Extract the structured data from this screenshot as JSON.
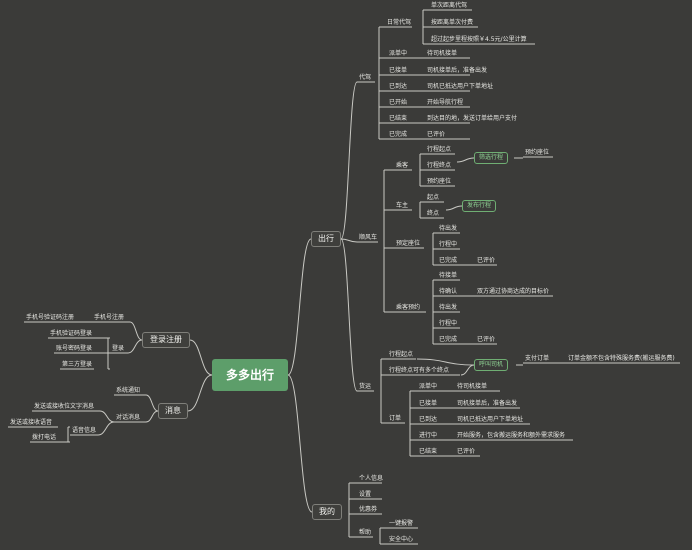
{
  "root": "多多出行",
  "left": {
    "login": {
      "label": "登录注册",
      "register": "手机号注册",
      "register_items": [
        "手机号验证码注册"
      ],
      "signin": "登录",
      "signin_items": [
        "手机验证码登录",
        "账号密码登录",
        "第三方登录"
      ]
    },
    "message": {
      "label": "消息",
      "system": "系统通知",
      "dialog": "对话消息",
      "dialog_items": [
        "发送或接收位文字消息"
      ],
      "voice": "语音信息",
      "voice_items": [
        "发送或接收语音",
        "拨打电话"
      ]
    }
  },
  "right": {
    "travel": {
      "label": "出行",
      "daijia": {
        "label": "代驾",
        "daily": "日常代驾",
        "daily_items": [
          "单次距离代驾",
          "按距离单次付费",
          "超过起步里程按照￥4.5元/公里计算"
        ],
        "states": [
          {
            "state": "派单中",
            "desc": "待司机接单"
          },
          {
            "state": "已接单",
            "desc": "司机接单后，准备出发"
          },
          {
            "state": "已到达",
            "desc": "司机已抵达用户下单地址"
          },
          {
            "state": "已开始",
            "desc": "开始导航行程"
          },
          {
            "state": "已结束",
            "desc": "到达目的地，发送订单给用户支付"
          },
          {
            "state": "已完成",
            "desc": "已评价"
          }
        ]
      },
      "shunfeng": {
        "label": "顺风车",
        "passenger": "乘客",
        "p_items": [
          "行程起点",
          "行程终点",
          "预约座位"
        ],
        "p_tag": "筛选行程",
        "p_next": "预约座位",
        "driver": "车主",
        "d_items": [
          "起点",
          "终点"
        ],
        "d_tag": "发布行程",
        "reserve": "预定座位",
        "r_items": [
          "待出发",
          "行程中",
          "已完成"
        ],
        "r_eval": "已评价",
        "pax_reserve": "乘客预约",
        "x_items": [
          "待接单",
          "待确认",
          "待出发",
          "行程中",
          "已完成"
        ],
        "x_confirm": "双方通过协商达成的目标价",
        "x_eval": "已评价"
      },
      "huoyun": {
        "label": "货运",
        "start": "行程起点",
        "ends": "行程终点可有多个终点",
        "tag": "呼叫司机",
        "pay": "支付订单",
        "pay_note": "订单金额不包含特殊服务费(搬运服务费)",
        "order": "订单",
        "states": [
          {
            "state": "派单中",
            "desc": "待司机接单"
          },
          {
            "state": "已接单",
            "desc": "司机接单后，准备出发"
          },
          {
            "state": "已到达",
            "desc": "司机已抵达用户下单地址"
          },
          {
            "state": "进行中",
            "desc": "开始服务，包含搬运服务和额外需求服务"
          },
          {
            "state": "已结束",
            "desc": "已评价"
          }
        ]
      }
    },
    "mine": {
      "label": "我的",
      "items": [
        "个人信息",
        "设置",
        "优惠券"
      ],
      "help": "帮助",
      "help_items": [
        "一键报警",
        "安全中心"
      ]
    }
  },
  "colors": {
    "background": "#3b3b39",
    "root": "#5d9e6a",
    "line": "#c9c9c4",
    "accent": "#6fae73"
  }
}
